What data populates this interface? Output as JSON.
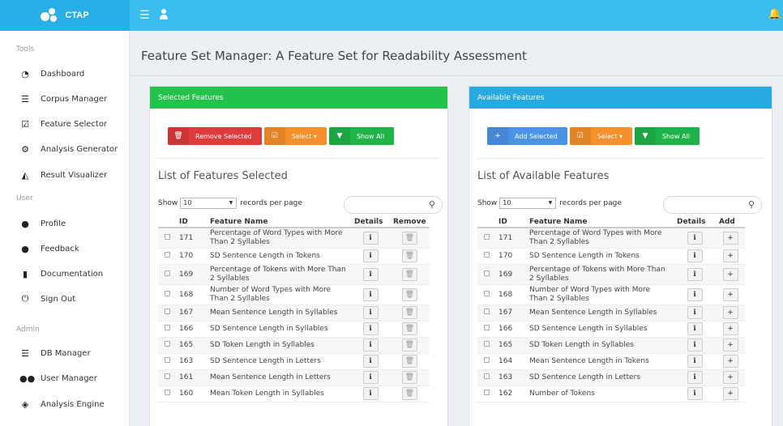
{
  "app": {
    "logo_text": "CTAP"
  },
  "sidebar": {
    "sections": [
      {
        "label": "Tools",
        "items": [
          {
            "label": "Dashboard",
            "icon": "dashboard-icon"
          },
          {
            "label": "Corpus Manager",
            "icon": "database-icon"
          },
          {
            "label": "Feature Selector",
            "icon": "checkbox-icon"
          },
          {
            "label": "Analysis Generator",
            "icon": "cogs-icon"
          },
          {
            "label": "Result Visualizer",
            "icon": "area-chart-icon"
          }
        ]
      },
      {
        "label": "User",
        "items": [
          {
            "label": "Profile",
            "icon": "user-icon"
          },
          {
            "label": "Feedback",
            "icon": "comment-icon"
          },
          {
            "label": "Documentation",
            "icon": "book-icon"
          },
          {
            "label": "Sign Out",
            "icon": "power-icon"
          }
        ]
      },
      {
        "label": "Admin",
        "items": [
          {
            "label": "DB Manager",
            "icon": "database-icon"
          },
          {
            "label": "User Manager",
            "icon": "users-icon"
          },
          {
            "label": "Analysis Engine",
            "icon": "cube-icon"
          }
        ]
      }
    ]
  },
  "page": {
    "title": "Feature Set Manager: A Feature Set for Readability Assessment"
  },
  "selected_panel": {
    "heading": "Selected Features",
    "remove_selected": "Remove Selected",
    "select_label": "Select",
    "show_all": "Show All",
    "list_title": "List of Features Selected",
    "show_label": "Show",
    "page_size": "10",
    "per_page_label": "records per page",
    "columns": {
      "id": "ID",
      "name": "Feature Name",
      "details": "Details",
      "action": "Remove"
    },
    "rows": [
      {
        "id": "171",
        "name": "Percentage of Word Types with More Than 2 Syllables"
      },
      {
        "id": "170",
        "name": "SD Sentence Length in Tokens"
      },
      {
        "id": "169",
        "name": "Percentage of Tokens with More Than 2 Syllables"
      },
      {
        "id": "168",
        "name": "Number of Word Types with More Than 2 Syllables"
      },
      {
        "id": "167",
        "name": "Mean Sentence Length in Syllables"
      },
      {
        "id": "166",
        "name": "SD Sentence Length in Syllables"
      },
      {
        "id": "165",
        "name": "SD Token Length in Syllables"
      },
      {
        "id": "163",
        "name": "SD Sentence Length in Letters"
      },
      {
        "id": "161",
        "name": "Mean Sentence Length in Letters"
      },
      {
        "id": "160",
        "name": "Mean Token Length in Syllables"
      }
    ]
  },
  "available_panel": {
    "heading": "Available Features",
    "add_selected": "Add Selected",
    "select_label": "Select",
    "show_all": "Show All",
    "list_title": "List of Available Features",
    "show_label": "Show",
    "page_size": "10",
    "per_page_label": "records per page",
    "columns": {
      "id": "ID",
      "name": "Feature Name",
      "details": "Details",
      "action": "Add"
    },
    "rows": [
      {
        "id": "171",
        "name": "Percentage of Word Types with More Than 2 Syllables"
      },
      {
        "id": "170",
        "name": "SD Sentence Length in Tokens"
      },
      {
        "id": "169",
        "name": "Percentage of Tokens with More Than 2 Syllables"
      },
      {
        "id": "168",
        "name": "Number of Word Types with More Than 2 Syllables"
      },
      {
        "id": "167",
        "name": "Mean Sentence Length in Syllables"
      },
      {
        "id": "166",
        "name": "SD Sentence Length in Syllables"
      },
      {
        "id": "165",
        "name": "SD Token Length in Syllables"
      },
      {
        "id": "164",
        "name": "Mean Sentence Length in Tokens"
      },
      {
        "id": "163",
        "name": "SD Sentence Length in Letters"
      },
      {
        "id": "162",
        "name": "Number of Tokens"
      }
    ]
  },
  "colors": {
    "topbar": "#3bbdf0",
    "selected_head": "#23c24c",
    "available_head": "#27a9e1",
    "remove": "#e03b3b",
    "select": "#f7902b",
    "show_all": "#1fb449",
    "add": "#4b93e6"
  }
}
